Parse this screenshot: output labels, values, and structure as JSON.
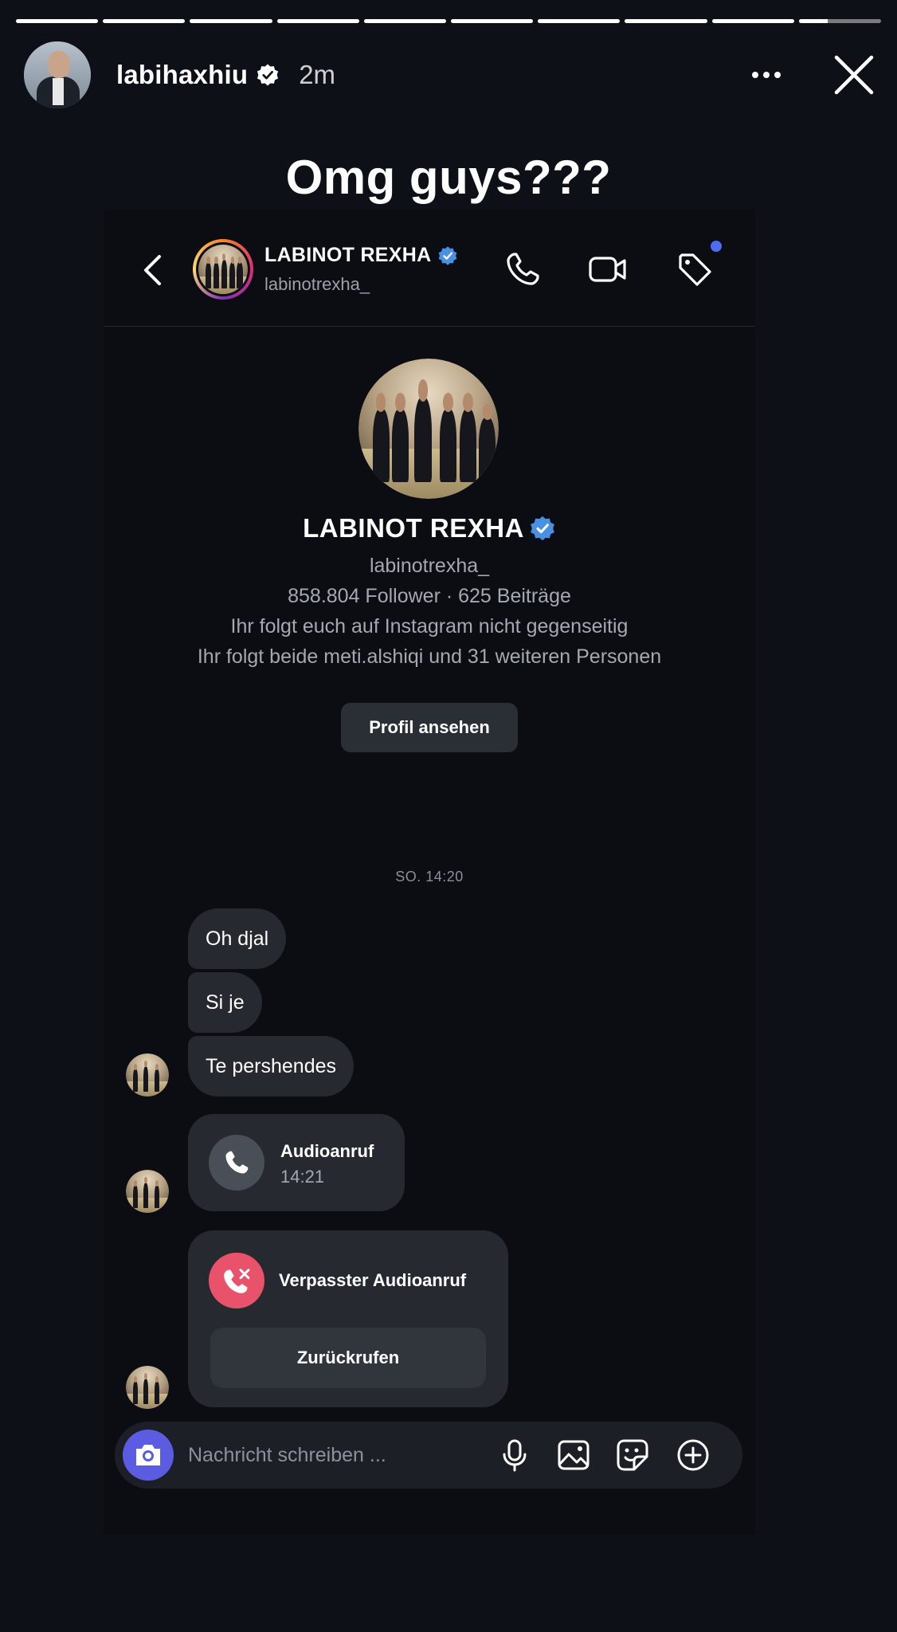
{
  "story": {
    "username": "labihaxhiu",
    "time_ago": "2m",
    "caption": "Omg guys???",
    "progress_segments": [
      1,
      1,
      1,
      1,
      1,
      1,
      1,
      1,
      1,
      0.35
    ]
  },
  "dm": {
    "contact_name": "LABINOT REXHA",
    "contact_handle": "labinotrexha_",
    "profile": {
      "name": "LABINOT REXHA",
      "handle": "labinotrexha_",
      "stats": "858.804 Follower · 625 Beiträge",
      "mutual_status": "Ihr folgt euch auf Instagram nicht gegenseitig",
      "followed_by": "Ihr folgt beide meti.alshiqi und 31 weiteren Personen",
      "view_profile_label": "Profil ansehen"
    },
    "date_separator": "SO. 14:20",
    "messages": [
      "Oh djal",
      "Si je",
      "Te pershendes"
    ],
    "audio_call": {
      "title": "Audioanruf",
      "time": "14:21"
    },
    "missed_call": {
      "title": "Verpasster Audioanruf",
      "callback_label": "Zurückrufen"
    },
    "composer": {
      "placeholder": "Nachricht schreiben ..."
    }
  },
  "colors": {
    "background": "#0d1016",
    "bubble": "#26292f",
    "verified_blue": "#4a90e2",
    "camera_button": "#5b5ce2",
    "missed_call_red": "#e8526a",
    "notification_dot": "#4c6ef5"
  },
  "icons": [
    "verified-icon",
    "more-icon",
    "close-icon",
    "back-icon",
    "phone-icon",
    "video-icon",
    "tag-icon",
    "camera-icon",
    "microphone-icon",
    "gallery-icon",
    "sticker-icon",
    "plus-icon",
    "missed-call-icon"
  ]
}
